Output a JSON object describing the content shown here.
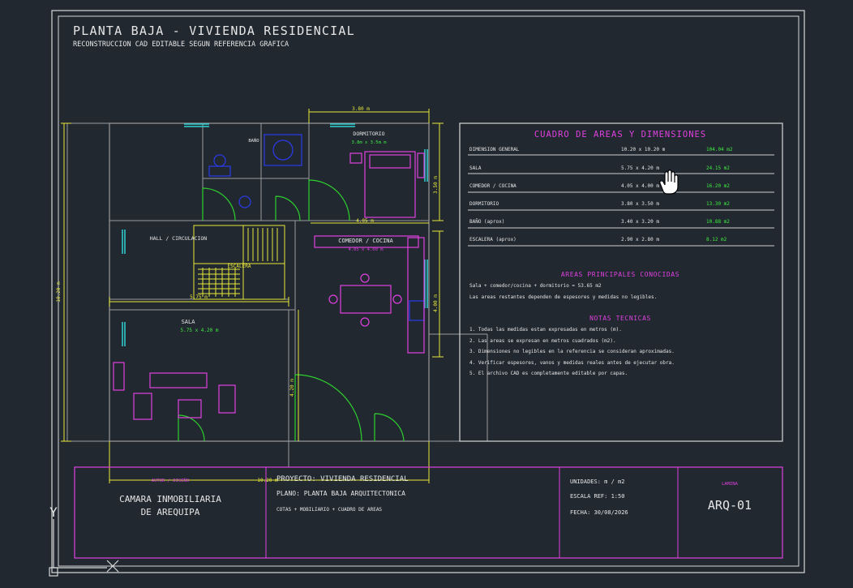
{
  "header": {
    "title": "PLANTA BAJA - VIVIENDA RESIDENCIAL",
    "subtitle": "RECONSTRUCCION CAD EDITABLE SEGUN REFERENCIA GRAFICA"
  },
  "dimensions": {
    "top": "3.80 m",
    "left": "10.20 m",
    "dorm_right": "3.50 m",
    "comedor_top": "4.05 m",
    "comedor_right": "4.00 m",
    "sala_top": "5.75 m",
    "sala_right": "4.20 m",
    "bottom": "10.20 m"
  },
  "rooms": {
    "bano": "BAÑO",
    "dormitorio": "DORMITORIO",
    "dormitorio_size": "3.8m x 3.5m m",
    "hall": "HALL / CIRCULACION",
    "escalera": "ESCALERA",
    "comedor": "COMEDOR / COCINA",
    "comedor_size": "4.05 x 4.00 m",
    "sala": "SALA",
    "sala_size": "5.75 x 4.20 m"
  },
  "areas_table": {
    "title": "CUADRO DE AREAS Y DIMENSIONES",
    "rows": [
      {
        "name": "DIMENSION GENERAL",
        "dims": "10.20 x 10.20 m",
        "area": "104.04 m2"
      },
      {
        "name": "SALA",
        "dims": "5.75 x 4.20 m",
        "area": "24.15 m2"
      },
      {
        "name": "COMEDOR / COCINA",
        "dims": "4.05 x 4.00 m",
        "area": "16.20 m2"
      },
      {
        "name": "DORMITORIO",
        "dims": "3.80 x 3.50 m",
        "area": "13.30 m2"
      },
      {
        "name": "BAÑO (aprox)",
        "dims": "3.40 x 3.20 m",
        "area": "10.88 m2"
      },
      {
        "name": "ESCALERA (aprox)",
        "dims": "2.90 x 2.80 m",
        "area": "8.12 m2"
      }
    ],
    "known_title": "AREAS PRINCIPALES CONOCIDAS",
    "known_line1": "Sala + comedor/cocina + dormitorio = 53.65 m2",
    "known_line2": "Las areas restantes dependen de espesores y medidas no legibles.",
    "notes_title": "NOTAS TECNICAS",
    "notes": [
      "1. Todas las medidas estan expresadas en metros (m).",
      "2. Las areas se expresan en metros cuadrados (m2).",
      "3. Dimensiones no legibles en la referencia se consideran aproximadas.",
      "4. Verificar espesores, vanos y medidas reales antes de ejecutar obra.",
      "5. El archivo CAD es completamente editable por capas."
    ]
  },
  "title_block": {
    "autor_label": "AUTOR / DISEÑO",
    "company_line1": "CAMARA INMOBILIARIA",
    "company_line2": "DE AREQUIPA",
    "proyecto": "PROYECTO: VIVIENDA RESIDENCIAL",
    "plano": "PLANO: PLANTA BAJA ARQUITECTONICA",
    "contenido": "COTAS + MOBILIARIO + CUADRO DE AREAS",
    "unidades": "UNIDADES: m / m2",
    "escala": "ESCALA REF: 1:50",
    "fecha": "FECHA: 30/08/2026",
    "lamina_label": "LAMINA",
    "lamina": "ARQ-01"
  },
  "ucs": {
    "y": "Y"
  },
  "colors": {
    "background": "#212830",
    "frame": "#e6e6e6",
    "wall": "#a8a8a8",
    "dimension": "#e8e83a",
    "furniture": "#e040e0",
    "door": "#2ed02e",
    "window": "#30d0d0",
    "fixture": "#2a3ae0"
  }
}
